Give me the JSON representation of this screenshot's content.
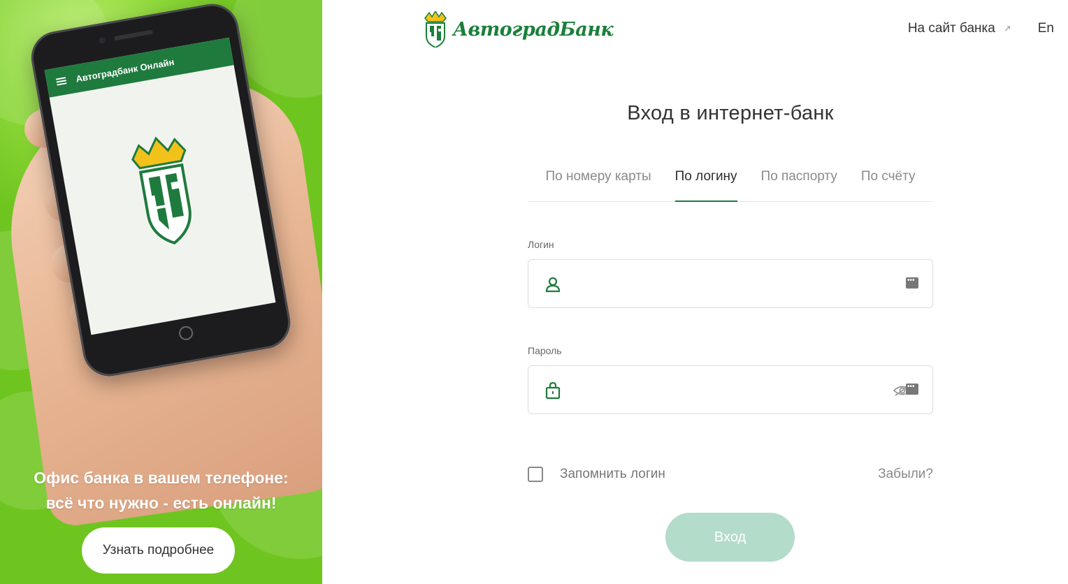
{
  "promo": {
    "phone_app_title": "Автоградбанк Онлайн",
    "headline_line1": "Офис банка в вашем телефоне:",
    "headline_line2": "всё что нужно - есть онлайн!",
    "cta_label": "Узнать подробнее"
  },
  "header": {
    "logo_text": "АвтоградБанк",
    "bank_site_link": "На сайт банка",
    "language": "En"
  },
  "form": {
    "title": "Вход в интернет-банк",
    "tabs": [
      {
        "label": "По номеру карты",
        "active": false
      },
      {
        "label": "По логину",
        "active": true
      },
      {
        "label": "По паспорту",
        "active": false
      },
      {
        "label": "По счёту",
        "active": false
      }
    ],
    "login_label": "Логин",
    "login_value": "",
    "password_label": "Пароль",
    "password_value": "",
    "remember_label": "Запомнить логин",
    "remember_checked": false,
    "forgot_label": "Забыли?",
    "submit_label": "Вход"
  },
  "colors": {
    "brand_green": "#1f7a3e",
    "promo_green": "#74cc22",
    "submit_disabled": "#b3dccb",
    "crown_yellow": "#f2c21b"
  }
}
